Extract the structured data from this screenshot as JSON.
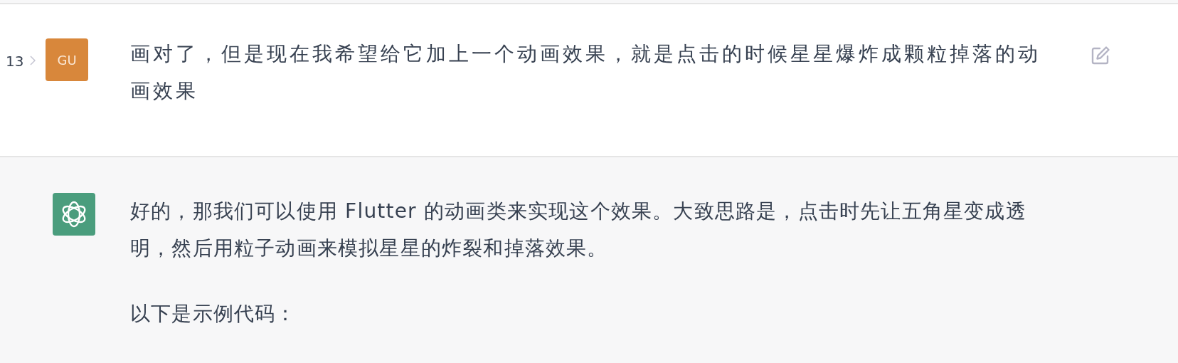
{
  "messages": [
    {
      "kind": "user",
      "index": "13",
      "avatar": "GU",
      "paragraphs": [
        "画对了，但是现在我希望给它加上一个动画效果，就是点击的时候星星爆炸成颗粒掉落的动画效果"
      ],
      "editable": true
    },
    {
      "kind": "assistant",
      "paragraphs": [
        "好的，那我们可以使用 Flutter 的动画类来实现这个效果。大致思路是，点击时先让五角星变成透明，然后用粒子动画来模拟星星的炸裂和掉落效果。",
        "以下是示例代码："
      ]
    }
  ]
}
